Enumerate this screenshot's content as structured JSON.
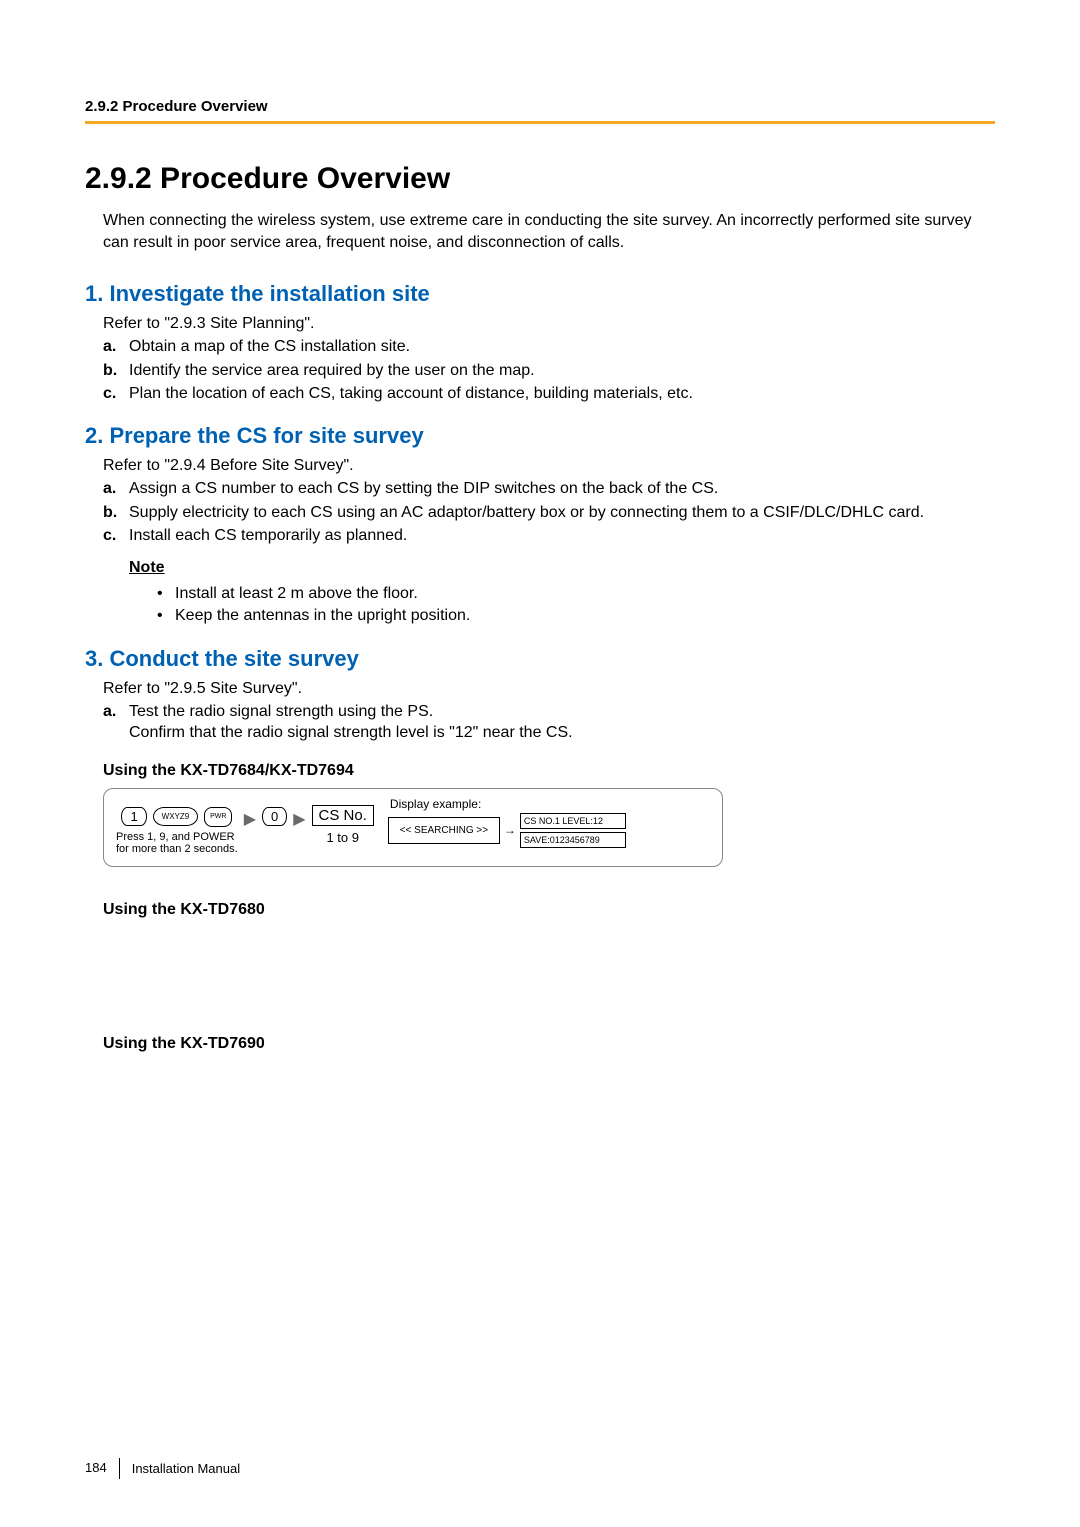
{
  "header": {
    "section": "2.9.2 Procedure Overview"
  },
  "title": "2.9.2  Procedure Overview",
  "intro": "When connecting the wireless system, use extreme care in conducting the site survey. An incorrectly performed site survey can result in poor service area, frequent noise, and disconnection of calls.",
  "s1": {
    "heading": "1. Investigate the installation site",
    "refer": "Refer to \"2.9.3  Site Planning\".",
    "items": [
      "Obtain a map of the CS installation site.",
      "Identify the service area required by the user on the map.",
      "Plan the location of each CS, taking account of distance, building materials, etc."
    ]
  },
  "s2": {
    "heading": "2. Prepare the CS for site survey",
    "refer": "Refer to \"2.9.4  Before Site Survey\".",
    "items": [
      "Assign a CS number to each CS by setting the DIP switches on the back of the CS.",
      "Supply electricity to each CS using an AC adaptor/battery box or by connecting them to a CSIF/DLC/DHLC card.",
      "Install each CS temporarily as planned."
    ],
    "note_title": "Note",
    "notes": [
      "Install at least 2 m above the floor.",
      "Keep the antennas in the upright position."
    ]
  },
  "s3": {
    "heading": "3. Conduct the site survey",
    "refer": "Refer to \"2.9.5  Site Survey\".",
    "item_a_line1": "Test the radio signal strength using the PS.",
    "item_a_line2": "Confirm that the radio signal strength level is \"12\" near the CS.",
    "sub1": "Using the KX-TD7684/KX-TD7694",
    "sub2": "Using the KX-TD7680",
    "sub3": "Using the KX-TD7690"
  },
  "diagram": {
    "key1": "1",
    "key9": "WXYZ9",
    "pwr": "PWR",
    "key0": "0",
    "csno": "CS No.",
    "csno_cap": "1 to 9",
    "press_caption_l1": "Press 1, 9, and POWER",
    "press_caption_l2": "for more than 2 seconds.",
    "display_title": "Display example:",
    "lcd_search": "<< SEARCHING >>",
    "lcd_cs": "CS NO.1 LEVEL:12",
    "lcd_save": "SAVE:0123456789"
  },
  "footer": {
    "page": "184",
    "doc": "Installation Manual"
  }
}
